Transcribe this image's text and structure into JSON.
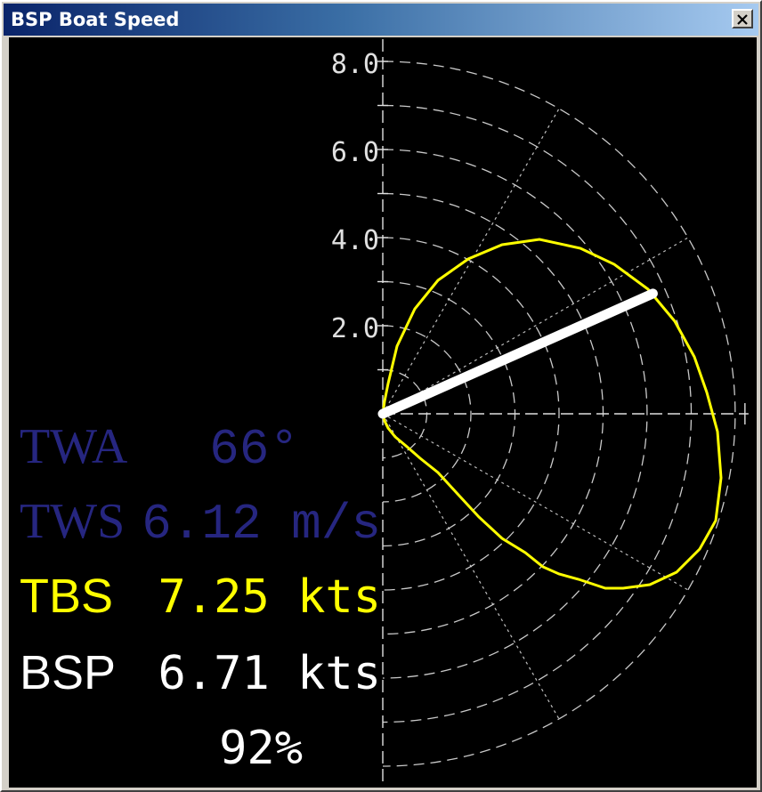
{
  "window": {
    "title": "BSP Boat Speed",
    "close_icon": "close-icon"
  },
  "colors": {
    "background": "#000000",
    "grid": "#e0e0e0",
    "twa_tws": "#262680",
    "tbs": "#ffff00",
    "bsp": "#ffffff"
  },
  "readouts": {
    "twa": {
      "label": "TWA",
      "value": "66°"
    },
    "tws": {
      "label": "TWS",
      "value": "6.12 m/s"
    },
    "tbs": {
      "label": "TBS",
      "value": "7.25 kts"
    },
    "bsp": {
      "label": "BSP",
      "value": "6.71 kts"
    },
    "percent": "92%"
  },
  "polar": {
    "radial_tick_labels": [
      "2.0",
      "4.0",
      "6.0",
      "8.0"
    ],
    "radial_tick_values": [
      2,
      4,
      6,
      8
    ],
    "max_speed": 8,
    "angle_spokes_deg": [
      0,
      30,
      60,
      90,
      120,
      150,
      180
    ],
    "boat_speed_kts": 6.71,
    "true_wind_angle_deg": 66
  }
}
